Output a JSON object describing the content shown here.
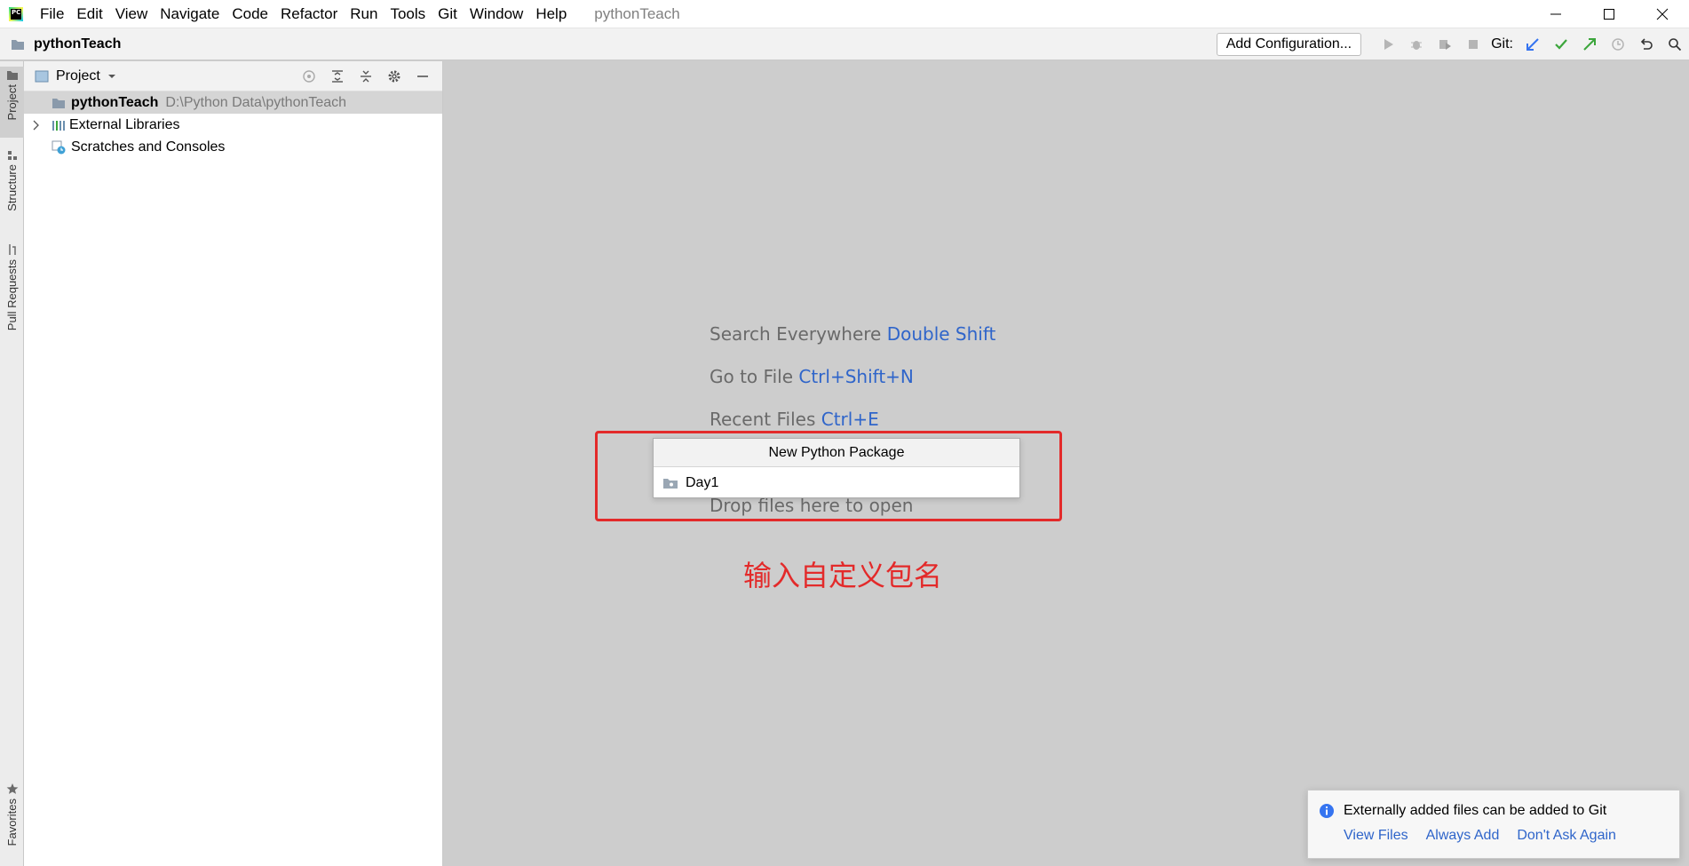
{
  "app": {
    "logo_text": "PC",
    "window_title": "pythonTeach"
  },
  "menu": [
    "File",
    "Edit",
    "View",
    "Navigate",
    "Code",
    "Refactor",
    "Run",
    "Tools",
    "Git",
    "Window",
    "Help"
  ],
  "navbar": {
    "project": "pythonTeach",
    "add_configuration": "Add Configuration...",
    "git_label": "Git:"
  },
  "stripe": {
    "project": "Project",
    "structure": "Structure",
    "pull_requests": "Pull Requests",
    "favorites": "Favorites"
  },
  "project_panel": {
    "title": "Project",
    "tree": {
      "root_name": "pythonTeach",
      "root_path": "D:\\Python Data\\pythonTeach",
      "external_libraries": "External Libraries",
      "scratches": "Scratches and Consoles"
    }
  },
  "hints": {
    "search": {
      "text": "Search Everywhere",
      "key": "Double Shift"
    },
    "goto_file": {
      "text": "Go to File",
      "key": "Ctrl+Shift+N"
    },
    "recent": {
      "text": "Recent Files",
      "key": "Ctrl+E"
    },
    "drop": "Drop files here to open"
  },
  "dialog": {
    "title": "New Python Package",
    "value": "Day1"
  },
  "annotation": "输入自定义包名",
  "notification": {
    "message": "Externally added files can be added to Git",
    "actions": [
      "View Files",
      "Always Add",
      "Don't Ask Again"
    ]
  },
  "colors": {
    "accent_blue": "#2f65ca",
    "annotation_red": "#e32a2a",
    "git_green": "#3ca63c"
  }
}
